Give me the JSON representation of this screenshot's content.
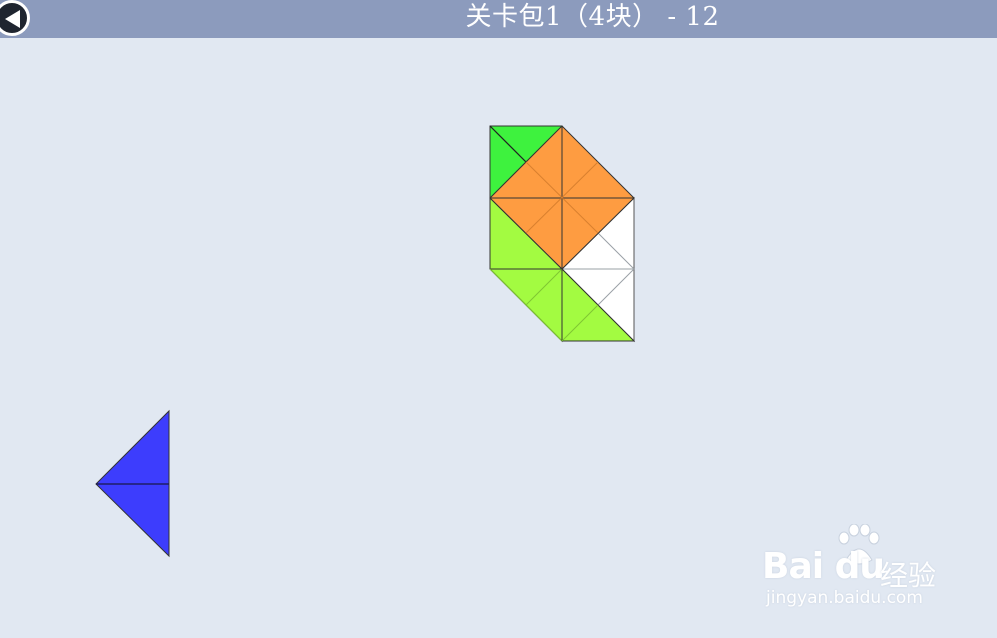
{
  "header": {
    "title": "关卡包1（4块） - 12",
    "back_icon": "back-arrow-icon"
  },
  "pieces": [
    {
      "name": "green",
      "color": "#3ef23e"
    },
    {
      "name": "orange",
      "color": "#fe9c41"
    },
    {
      "name": "white",
      "color": "#ffffff"
    },
    {
      "name": "lime",
      "color": "#a3fb41"
    },
    {
      "name": "blue",
      "color": "#3d3dfd"
    }
  ],
  "watermark": {
    "brand": "Bai  du",
    "suffix": "经验",
    "url": "jingyan.baidu.com"
  },
  "colors": {
    "header_bg": "#8c9bbd",
    "board_bg": "#e1e8f2"
  }
}
